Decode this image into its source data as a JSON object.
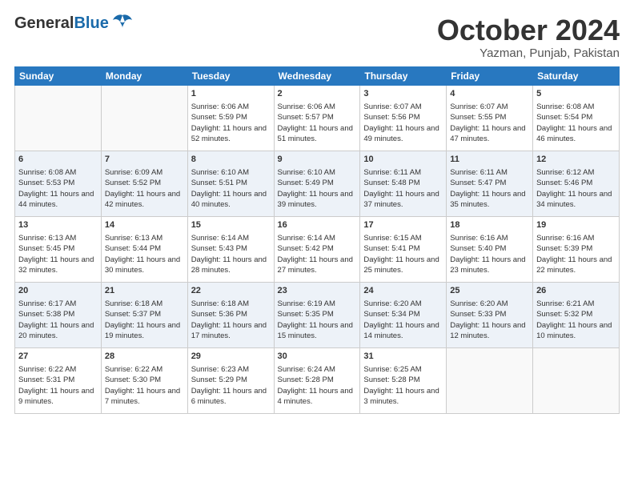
{
  "header": {
    "logo_general": "General",
    "logo_blue": "Blue",
    "month_title": "October 2024",
    "location": "Yazman, Punjab, Pakistan"
  },
  "weekdays": [
    "Sunday",
    "Monday",
    "Tuesday",
    "Wednesday",
    "Thursday",
    "Friday",
    "Saturday"
  ],
  "weeks": [
    [
      {
        "day": "",
        "sunrise": "",
        "sunset": "",
        "daylight": ""
      },
      {
        "day": "",
        "sunrise": "",
        "sunset": "",
        "daylight": ""
      },
      {
        "day": "1",
        "sunrise": "Sunrise: 6:06 AM",
        "sunset": "Sunset: 5:59 PM",
        "daylight": "Daylight: 11 hours and 52 minutes."
      },
      {
        "day": "2",
        "sunrise": "Sunrise: 6:06 AM",
        "sunset": "Sunset: 5:57 PM",
        "daylight": "Daylight: 11 hours and 51 minutes."
      },
      {
        "day": "3",
        "sunrise": "Sunrise: 6:07 AM",
        "sunset": "Sunset: 5:56 PM",
        "daylight": "Daylight: 11 hours and 49 minutes."
      },
      {
        "day": "4",
        "sunrise": "Sunrise: 6:07 AM",
        "sunset": "Sunset: 5:55 PM",
        "daylight": "Daylight: 11 hours and 47 minutes."
      },
      {
        "day": "5",
        "sunrise": "Sunrise: 6:08 AM",
        "sunset": "Sunset: 5:54 PM",
        "daylight": "Daylight: 11 hours and 46 minutes."
      }
    ],
    [
      {
        "day": "6",
        "sunrise": "Sunrise: 6:08 AM",
        "sunset": "Sunset: 5:53 PM",
        "daylight": "Daylight: 11 hours and 44 minutes."
      },
      {
        "day": "7",
        "sunrise": "Sunrise: 6:09 AM",
        "sunset": "Sunset: 5:52 PM",
        "daylight": "Daylight: 11 hours and 42 minutes."
      },
      {
        "day": "8",
        "sunrise": "Sunrise: 6:10 AM",
        "sunset": "Sunset: 5:51 PM",
        "daylight": "Daylight: 11 hours and 40 minutes."
      },
      {
        "day": "9",
        "sunrise": "Sunrise: 6:10 AM",
        "sunset": "Sunset: 5:49 PM",
        "daylight": "Daylight: 11 hours and 39 minutes."
      },
      {
        "day": "10",
        "sunrise": "Sunrise: 6:11 AM",
        "sunset": "Sunset: 5:48 PM",
        "daylight": "Daylight: 11 hours and 37 minutes."
      },
      {
        "day": "11",
        "sunrise": "Sunrise: 6:11 AM",
        "sunset": "Sunset: 5:47 PM",
        "daylight": "Daylight: 11 hours and 35 minutes."
      },
      {
        "day": "12",
        "sunrise": "Sunrise: 6:12 AM",
        "sunset": "Sunset: 5:46 PM",
        "daylight": "Daylight: 11 hours and 34 minutes."
      }
    ],
    [
      {
        "day": "13",
        "sunrise": "Sunrise: 6:13 AM",
        "sunset": "Sunset: 5:45 PM",
        "daylight": "Daylight: 11 hours and 32 minutes."
      },
      {
        "day": "14",
        "sunrise": "Sunrise: 6:13 AM",
        "sunset": "Sunset: 5:44 PM",
        "daylight": "Daylight: 11 hours and 30 minutes."
      },
      {
        "day": "15",
        "sunrise": "Sunrise: 6:14 AM",
        "sunset": "Sunset: 5:43 PM",
        "daylight": "Daylight: 11 hours and 28 minutes."
      },
      {
        "day": "16",
        "sunrise": "Sunrise: 6:14 AM",
        "sunset": "Sunset: 5:42 PM",
        "daylight": "Daylight: 11 hours and 27 minutes."
      },
      {
        "day": "17",
        "sunrise": "Sunrise: 6:15 AM",
        "sunset": "Sunset: 5:41 PM",
        "daylight": "Daylight: 11 hours and 25 minutes."
      },
      {
        "day": "18",
        "sunrise": "Sunrise: 6:16 AM",
        "sunset": "Sunset: 5:40 PM",
        "daylight": "Daylight: 11 hours and 23 minutes."
      },
      {
        "day": "19",
        "sunrise": "Sunrise: 6:16 AM",
        "sunset": "Sunset: 5:39 PM",
        "daylight": "Daylight: 11 hours and 22 minutes."
      }
    ],
    [
      {
        "day": "20",
        "sunrise": "Sunrise: 6:17 AM",
        "sunset": "Sunset: 5:38 PM",
        "daylight": "Daylight: 11 hours and 20 minutes."
      },
      {
        "day": "21",
        "sunrise": "Sunrise: 6:18 AM",
        "sunset": "Sunset: 5:37 PM",
        "daylight": "Daylight: 11 hours and 19 minutes."
      },
      {
        "day": "22",
        "sunrise": "Sunrise: 6:18 AM",
        "sunset": "Sunset: 5:36 PM",
        "daylight": "Daylight: 11 hours and 17 minutes."
      },
      {
        "day": "23",
        "sunrise": "Sunrise: 6:19 AM",
        "sunset": "Sunset: 5:35 PM",
        "daylight": "Daylight: 11 hours and 15 minutes."
      },
      {
        "day": "24",
        "sunrise": "Sunrise: 6:20 AM",
        "sunset": "Sunset: 5:34 PM",
        "daylight": "Daylight: 11 hours and 14 minutes."
      },
      {
        "day": "25",
        "sunrise": "Sunrise: 6:20 AM",
        "sunset": "Sunset: 5:33 PM",
        "daylight": "Daylight: 11 hours and 12 minutes."
      },
      {
        "day": "26",
        "sunrise": "Sunrise: 6:21 AM",
        "sunset": "Sunset: 5:32 PM",
        "daylight": "Daylight: 11 hours and 10 minutes."
      }
    ],
    [
      {
        "day": "27",
        "sunrise": "Sunrise: 6:22 AM",
        "sunset": "Sunset: 5:31 PM",
        "daylight": "Daylight: 11 hours and 9 minutes."
      },
      {
        "day": "28",
        "sunrise": "Sunrise: 6:22 AM",
        "sunset": "Sunset: 5:30 PM",
        "daylight": "Daylight: 11 hours and 7 minutes."
      },
      {
        "day": "29",
        "sunrise": "Sunrise: 6:23 AM",
        "sunset": "Sunset: 5:29 PM",
        "daylight": "Daylight: 11 hours and 6 minutes."
      },
      {
        "day": "30",
        "sunrise": "Sunrise: 6:24 AM",
        "sunset": "Sunset: 5:28 PM",
        "daylight": "Daylight: 11 hours and 4 minutes."
      },
      {
        "day": "31",
        "sunrise": "Sunrise: 6:25 AM",
        "sunset": "Sunset: 5:28 PM",
        "daylight": "Daylight: 11 hours and 3 minutes."
      },
      {
        "day": "",
        "sunrise": "",
        "sunset": "",
        "daylight": ""
      },
      {
        "day": "",
        "sunrise": "",
        "sunset": "",
        "daylight": ""
      }
    ]
  ]
}
